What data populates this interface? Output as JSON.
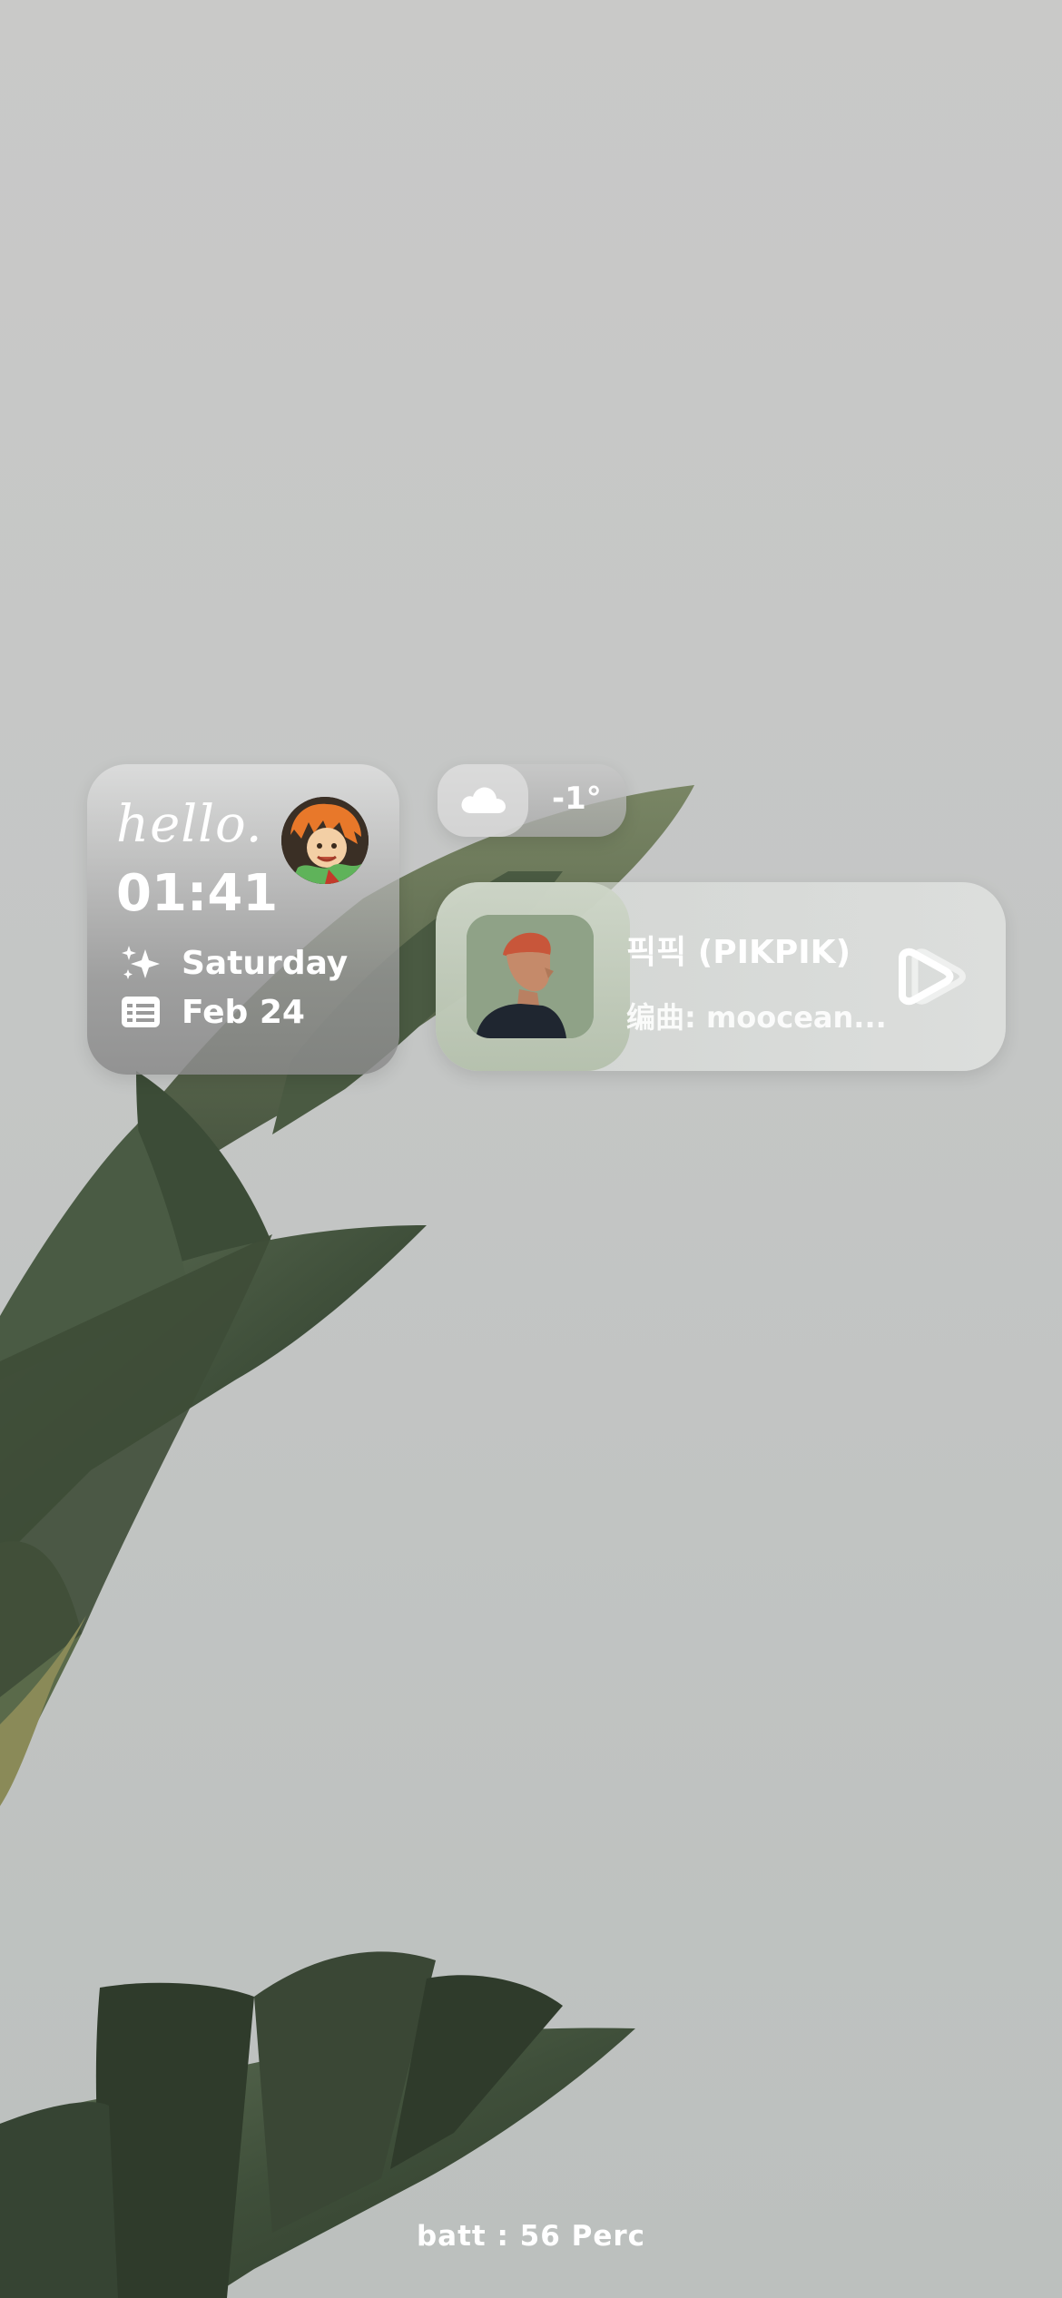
{
  "clock_widget": {
    "greeting": "hello.",
    "time": "01:41",
    "day": "Saturday",
    "date": "Feb 24",
    "day_icon": "sparkles-icon",
    "date_icon": "calendar-list-icon"
  },
  "weather_widget": {
    "icon": "cloud-icon",
    "temperature": "-1°"
  },
  "music_widget": {
    "title": "픽픽 (PIKPIK)",
    "subtitle": "编曲: moocean...",
    "play_icon": "play-icon"
  },
  "footer": {
    "battery": "batt : 56 Perc"
  }
}
